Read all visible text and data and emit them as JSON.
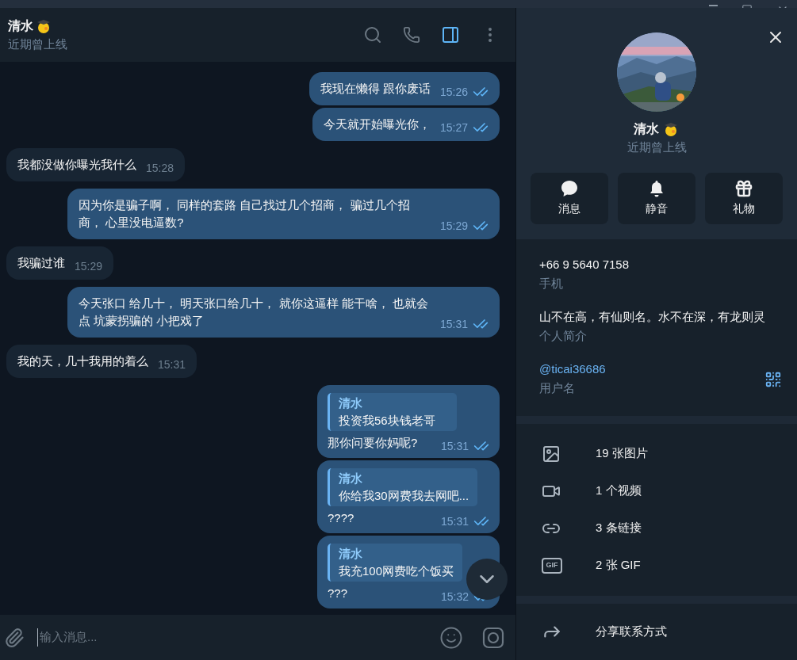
{
  "header": {
    "name": "清水",
    "status": "近期曾上线",
    "info_panel_open": true
  },
  "messages": [
    {
      "kind": "outgoing",
      "text": "我现在懒得 跟你废话",
      "time": "15:26",
      "read": true
    },
    {
      "kind": "outgoing",
      "text": "今天就开始曝光你，",
      "time": "15:27",
      "read": true
    },
    {
      "kind": "incoming",
      "text": "我都没做你曝光我什么",
      "time": "15:28"
    },
    {
      "kind": "outgoing",
      "text": "因为你是骗子啊， 同样的套路 自己找过几个招商， 骗过几个招商， 心里没电逼数?",
      "time": "15:29",
      "read": true
    },
    {
      "kind": "incoming",
      "text": "我骗过谁",
      "time": "15:29"
    },
    {
      "kind": "outgoing",
      "text": "今天张口 给几十， 明天张口给几十， 就你这逼样 能干啥， 也就会点 坑蒙拐骗的 小把戏了",
      "time": "15:31",
      "read": true
    },
    {
      "kind": "incoming",
      "text": "我的天，几十我用的着么",
      "time": "15:31"
    },
    {
      "kind": "outgoing",
      "reply": {
        "name": "清水",
        "text": "投资我56块钱老哥"
      },
      "text": "那你问要你妈呢?",
      "time": "15:31",
      "read": true
    },
    {
      "kind": "outgoing",
      "reply": {
        "name": "清水",
        "text": "你给我30网费我去网吧..."
      },
      "text": "????",
      "time": "15:31",
      "read": true
    },
    {
      "kind": "outgoing",
      "reply": {
        "name": "清水",
        "text": "我充100网费吃个饭买"
      },
      "text": "???",
      "time": "15:32",
      "read": true
    }
  ],
  "composer": {
    "placeholder": "输入消息..."
  },
  "profile": {
    "name": "清水",
    "status": "近期曾上线",
    "actions": [
      {
        "kind": "message",
        "label": "消息"
      },
      {
        "kind": "mute",
        "label": "静音"
      },
      {
        "kind": "gift",
        "label": "礼物"
      }
    ],
    "phone": {
      "value": "+66 9 5640 7158",
      "label": "手机"
    },
    "bio": {
      "value": "山不在高，有仙则名。水不在深，有龙则灵",
      "label": "个人简介"
    },
    "username": {
      "value": "@ticai36686",
      "label": "用户名"
    },
    "media": [
      {
        "kind": "photos",
        "label": "19 张图片"
      },
      {
        "kind": "videos",
        "label": "1 个视频"
      },
      {
        "kind": "links",
        "label": "3 条链接"
      },
      {
        "kind": "gifs",
        "label": "2 张 GIF",
        "badge": "GIF"
      }
    ],
    "share": "分享联系方式"
  }
}
